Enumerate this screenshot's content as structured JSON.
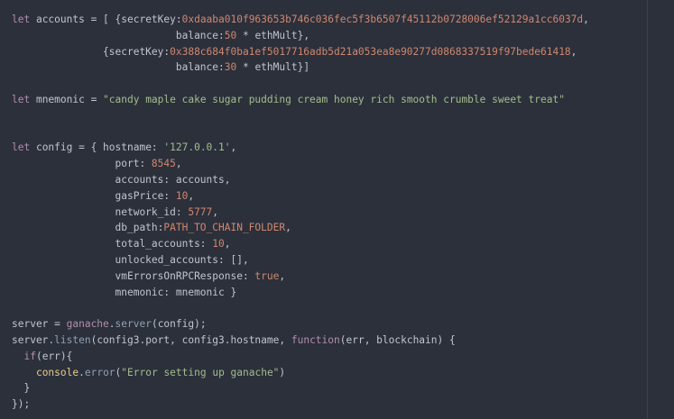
{
  "theme": {
    "background": "#2b303b",
    "keyword": "#b48ead",
    "function": "#8fa1b3",
    "number": "#d08770",
    "string": "#a3be8c",
    "text": "#c0c5ce",
    "object": "#ebcb8b"
  },
  "lines": [
    [
      {
        "t": "let",
        "c": "keyword"
      },
      {
        "t": " accounts = [ {secretKey:",
        "c": "text"
      },
      {
        "t": "0xdaaba010f963653b746c036fec5f3b6507f45112b0728006ef52129a1cc6037d",
        "c": "number"
      },
      {
        "t": ",",
        "c": "text"
      }
    ],
    [
      {
        "t": "                           balance:",
        "c": "text"
      },
      {
        "t": "50",
        "c": "number"
      },
      {
        "t": " * ethMult},",
        "c": "text"
      }
    ],
    [
      {
        "t": "               {secretKey:",
        "c": "text"
      },
      {
        "t": "0x388c684f0ba1ef5017716adb5d21a053ea8e90277d0868337519f97bede61418",
        "c": "number"
      },
      {
        "t": ",",
        "c": "text"
      }
    ],
    [
      {
        "t": "                           balance:",
        "c": "text"
      },
      {
        "t": "30",
        "c": "number"
      },
      {
        "t": " * ethMult}]",
        "c": "text"
      }
    ],
    [],
    [
      {
        "t": "let",
        "c": "keyword"
      },
      {
        "t": " mnemonic = ",
        "c": "text"
      },
      {
        "t": "\"candy maple cake sugar pudding cream honey rich smooth crumble sweet treat\"",
        "c": "string"
      }
    ],
    [],
    [],
    [
      {
        "t": "let",
        "c": "keyword"
      },
      {
        "t": " config = { hostname: ",
        "c": "text"
      },
      {
        "t": "'127.0.0.1'",
        "c": "string"
      },
      {
        "t": ",",
        "c": "text"
      }
    ],
    [
      {
        "t": "                 port: ",
        "c": "text"
      },
      {
        "t": "8545",
        "c": "number"
      },
      {
        "t": ",",
        "c": "text"
      }
    ],
    [
      {
        "t": "                 accounts: accounts,",
        "c": "text"
      }
    ],
    [
      {
        "t": "                 gasPrice: ",
        "c": "text"
      },
      {
        "t": "10",
        "c": "number"
      },
      {
        "t": ",",
        "c": "text"
      }
    ],
    [
      {
        "t": "                 network_id: ",
        "c": "text"
      },
      {
        "t": "5777",
        "c": "number"
      },
      {
        "t": ",",
        "c": "text"
      }
    ],
    [
      {
        "t": "                 db_path:",
        "c": "text"
      },
      {
        "t": "PATH_TO_CHAIN_FOLDER",
        "c": "number"
      },
      {
        "t": ",",
        "c": "text"
      }
    ],
    [
      {
        "t": "                 total_accounts: ",
        "c": "text"
      },
      {
        "t": "10",
        "c": "number"
      },
      {
        "t": ",",
        "c": "text"
      }
    ],
    [
      {
        "t": "                 unlocked_accounts: [],",
        "c": "text"
      }
    ],
    [
      {
        "t": "                 vmErrorsOnRPCResponse: ",
        "c": "text"
      },
      {
        "t": "true",
        "c": "number"
      },
      {
        "t": ",",
        "c": "text"
      }
    ],
    [
      {
        "t": "                 mnemonic: mnemonic }",
        "c": "text"
      }
    ],
    [],
    [
      {
        "t": "server = ",
        "c": "text"
      },
      {
        "t": "ganache",
        "c": "keyword"
      },
      {
        "t": ".",
        "c": "text"
      },
      {
        "t": "server",
        "c": "function"
      },
      {
        "t": "(config);",
        "c": "text"
      }
    ],
    [
      {
        "t": "server.",
        "c": "text"
      },
      {
        "t": "listen",
        "c": "function"
      },
      {
        "t": "(config3.port, config3.hostname, ",
        "c": "text"
      },
      {
        "t": "function",
        "c": "keyword"
      },
      {
        "t": "(err, blockchain) {",
        "c": "text"
      }
    ],
    [
      {
        "t": "  ",
        "c": "text"
      },
      {
        "t": "if",
        "c": "keyword"
      },
      {
        "t": "(err){",
        "c": "text"
      }
    ],
    [
      {
        "t": "    ",
        "c": "text"
      },
      {
        "t": "console",
        "c": "object"
      },
      {
        "t": ".",
        "c": "text"
      },
      {
        "t": "error",
        "c": "function"
      },
      {
        "t": "(",
        "c": "text"
      },
      {
        "t": "\"Error setting up ganache\"",
        "c": "string"
      },
      {
        "t": ")",
        "c": "text"
      }
    ],
    [
      {
        "t": "  }",
        "c": "text"
      }
    ],
    [
      {
        "t": "});",
        "c": "text"
      }
    ]
  ]
}
